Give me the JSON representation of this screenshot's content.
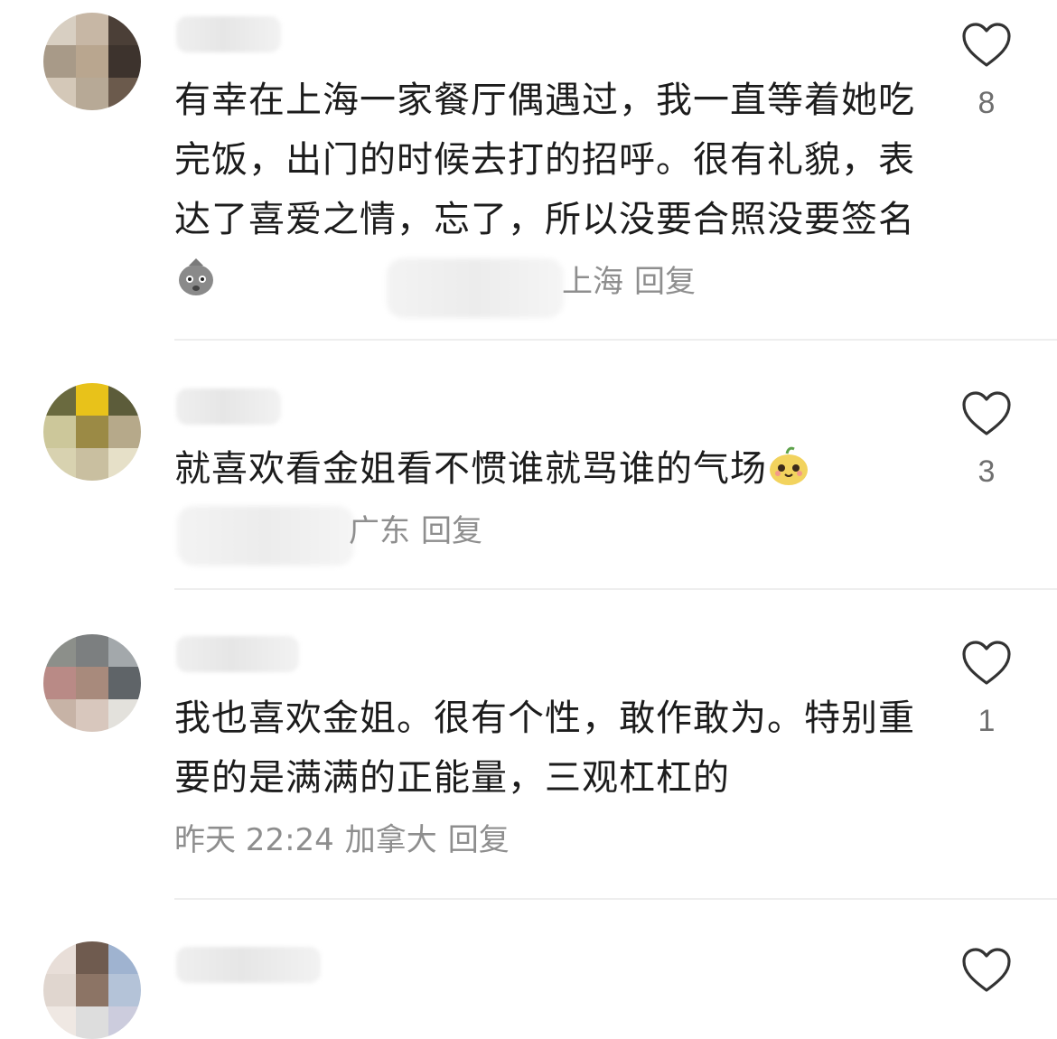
{
  "comments": [
    {
      "text": "有幸在上海一家餐厅偶遇过，我一直等着她吃完饭，出门的时候去打的招呼。很有礼貌，表达了喜爱之情，忘了，所以没要合照没要签名",
      "emoji": "sweat-bag-emoji",
      "location": "上海",
      "reply_label": "回复",
      "likes": "8"
    },
    {
      "text": "就喜欢看金姐看不惯谁就骂谁的气场",
      "emoji": "cute-face-emoji",
      "location": "广东",
      "reply_label": "回复",
      "likes": "3"
    },
    {
      "text": "我也喜欢金姐。很有个性，敢作敢为。特别重要的是满满的正能量，三观杠杠的",
      "time": "昨天 22:24",
      "location": "加拿大",
      "reply_label": "回复",
      "likes": "1"
    }
  ],
  "icons": {
    "like": "heart-outline-icon"
  },
  "colors": {
    "text": "#1c1c1c",
    "meta": "#8e8e8e",
    "like_count": "#6f6f6f",
    "divider": "#eeeeee"
  }
}
